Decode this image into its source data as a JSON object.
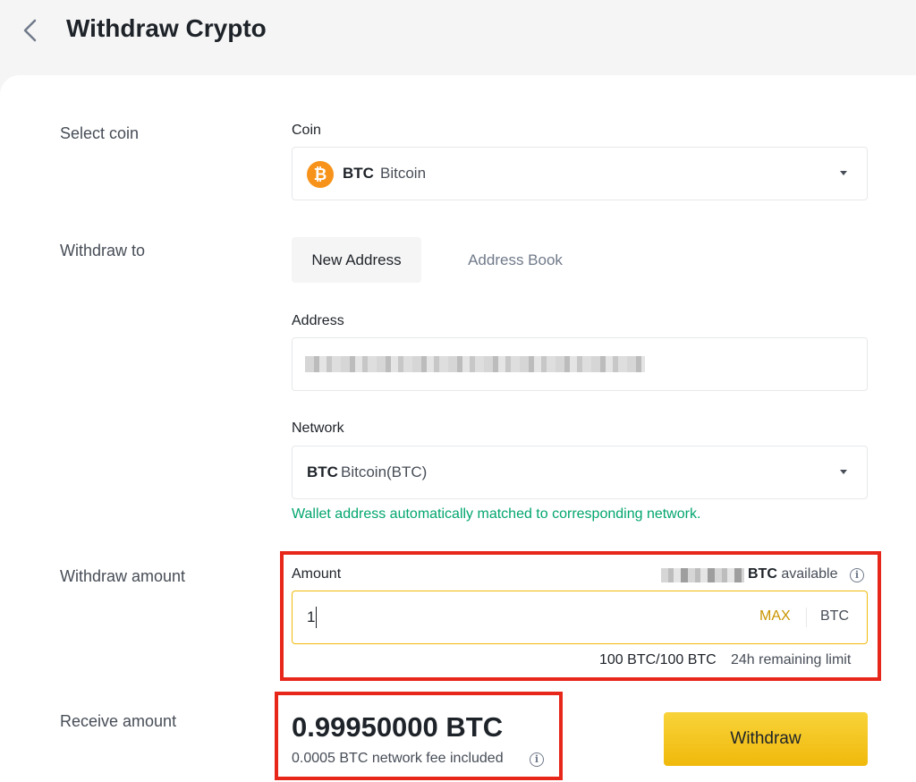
{
  "page": {
    "title": "Withdraw Crypto"
  },
  "coin_row": {
    "row_label": "Select coin",
    "field_label": "Coin",
    "logo_glyph": "₿",
    "symbol": "BTC",
    "name": "Bitcoin"
  },
  "withdraw_to": {
    "row_label": "Withdraw to",
    "tabs": [
      {
        "label": "New Address",
        "active": true
      },
      {
        "label": "Address Book",
        "active": false
      }
    ],
    "address_label": "Address",
    "network_label": "Network",
    "network_symbol": "BTC",
    "network_name": "Bitcoin(BTC)",
    "network_hint": "Wallet address automatically matched to corresponding network."
  },
  "amount_row": {
    "row_label": "Withdraw amount",
    "field_label": "Amount",
    "available_unit": "BTC",
    "available_suffix": "available",
    "value": "1",
    "max_label": "MAX",
    "unit": "BTC",
    "limit_value": "100 BTC/100 BTC",
    "limit_label": "24h remaining limit"
  },
  "receive_row": {
    "row_label": "Receive amount",
    "value": "0.99950000 BTC",
    "fee_text": "0.0005 BTC network fee included"
  },
  "actions": {
    "withdraw_label": "Withdraw"
  },
  "colors": {
    "accent": "#f0b90b",
    "success": "#03a66d",
    "highlight": "#e8271b",
    "coin": "#f7931a",
    "max_text": "#c99400"
  },
  "icons": [
    "back-arrow-icon",
    "bitcoin-logo-icon",
    "chevron-down-icon",
    "info-icon"
  ]
}
